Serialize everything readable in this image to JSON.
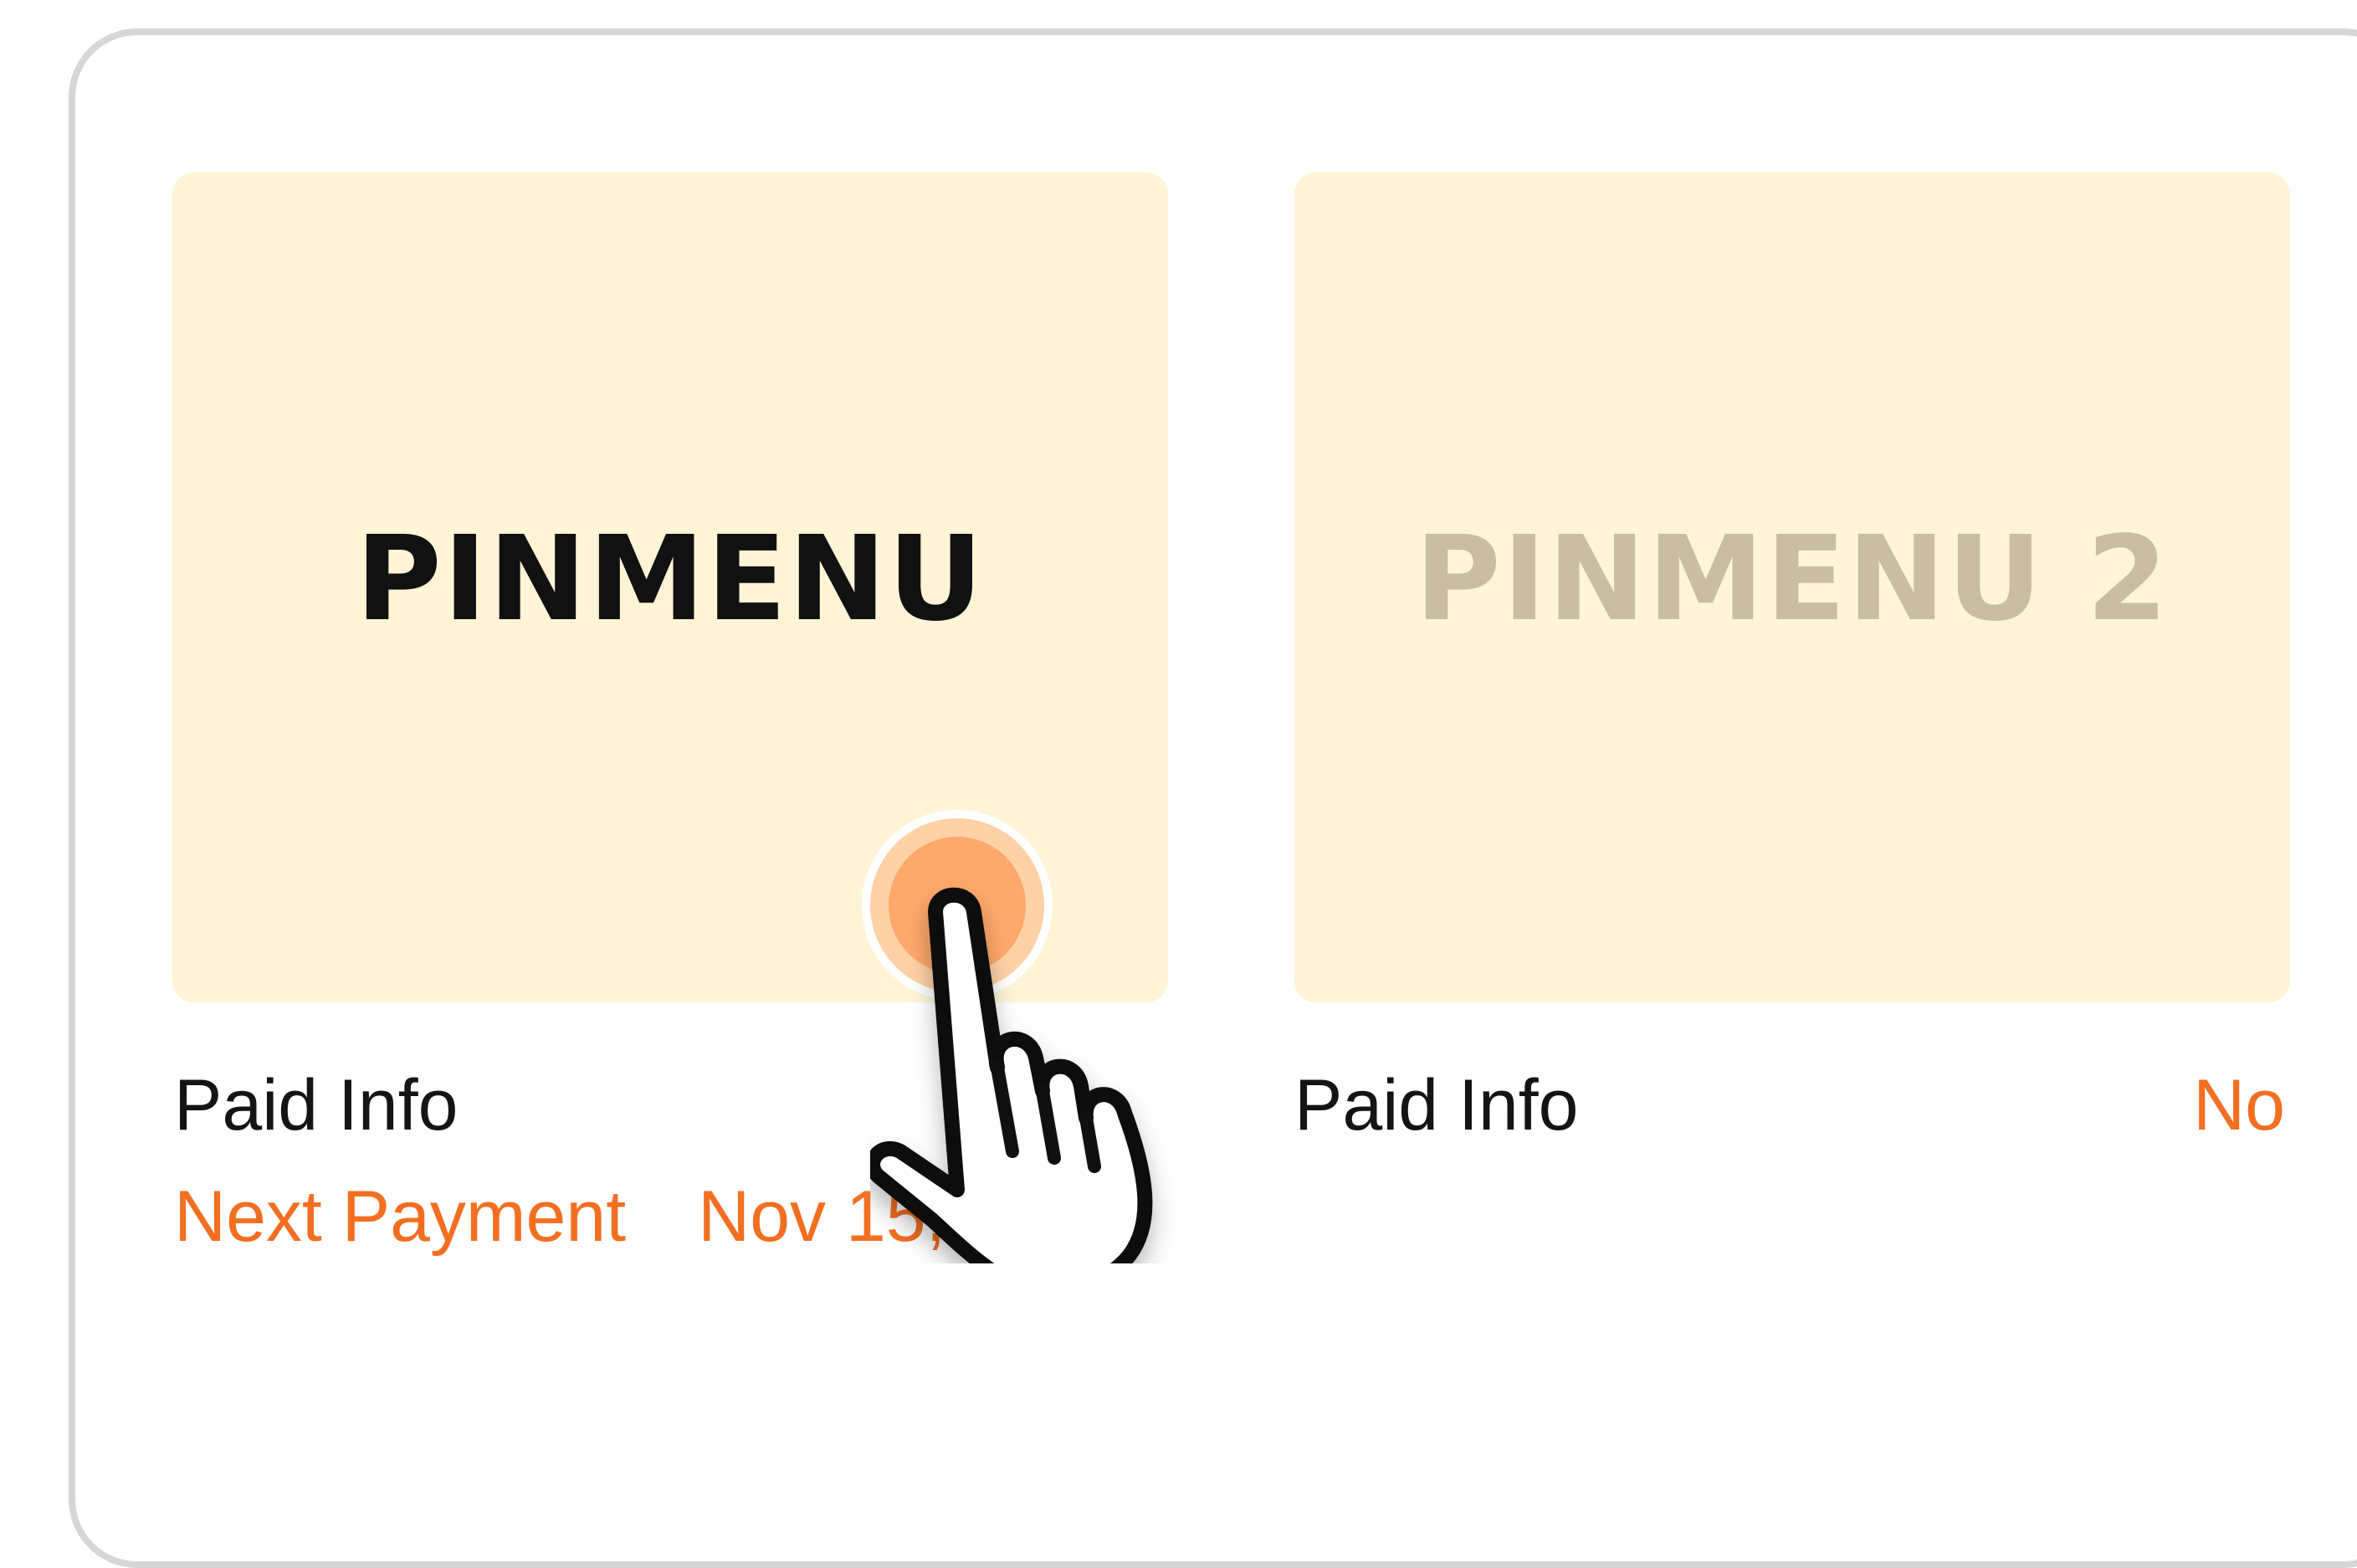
{
  "cards": [
    {
      "title": "PINMENU",
      "paid_info_label": "Paid Info",
      "next_payment_label": "Next Payment",
      "next_payment_date": "Nov 15, 2024"
    },
    {
      "title": "PINMENU 2",
      "paid_info_label": "Paid Info",
      "paid_status": "No"
    }
  ],
  "colors": {
    "card_background": "#fff4d6",
    "accent": "#f26f22",
    "title_active": "#111111",
    "title_inactive": "#c9bda2",
    "frame_border": "#d6d6d6"
  },
  "icons": {
    "pointer": "hand-pointer-icon",
    "touch": "tap-indicator-icon"
  }
}
